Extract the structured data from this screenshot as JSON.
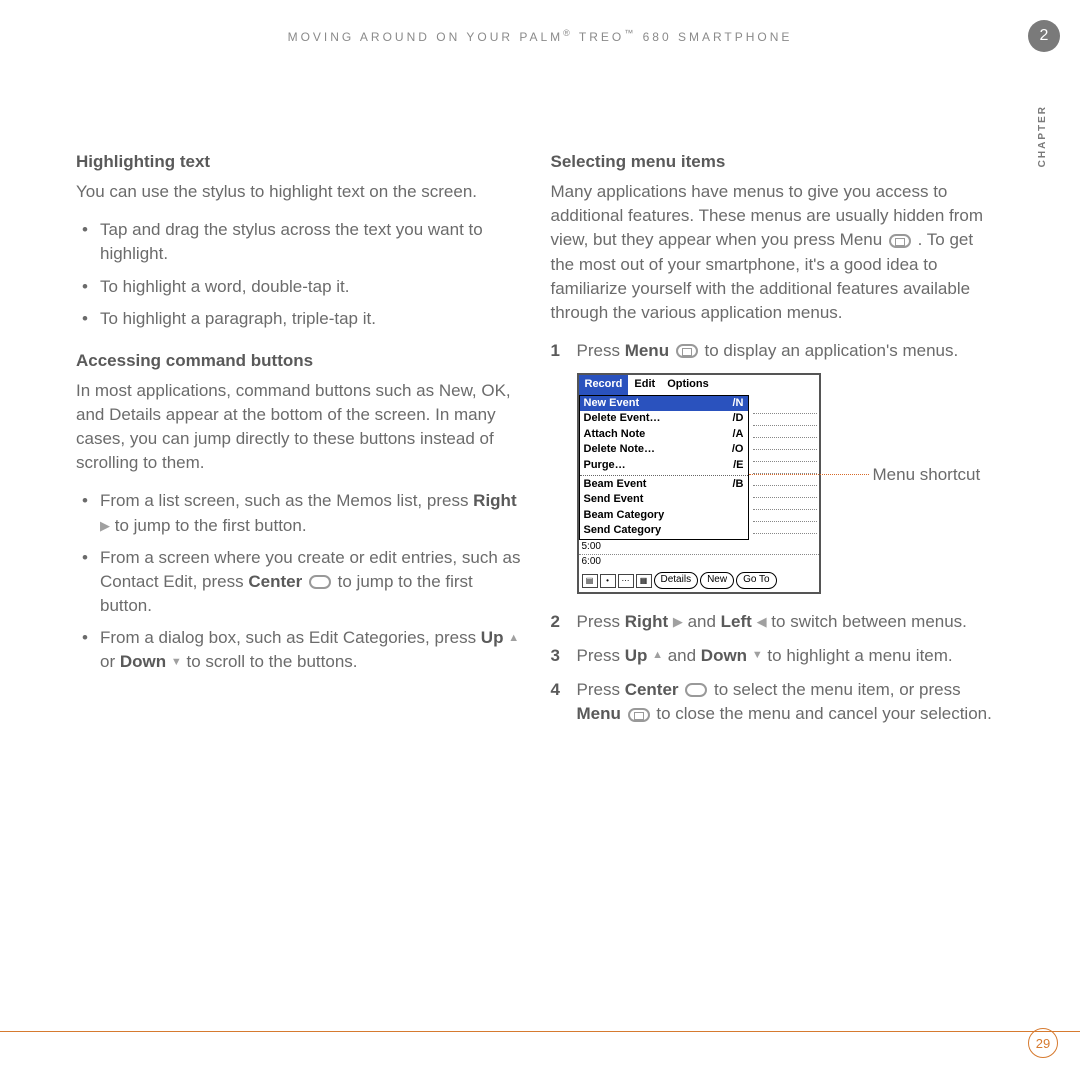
{
  "header": {
    "running_title_pre": "MOVING AROUND ON YOUR PALM",
    "running_title_mid": " TREO",
    "running_title_post": " 680 SMARTPHONE",
    "reg": "®",
    "tm": "™"
  },
  "chapter": {
    "number": "2",
    "label": "CHAPTER"
  },
  "left": {
    "h1": "Highlighting text",
    "p1": "You can use the stylus to highlight text on the screen.",
    "bullets1": [
      "Tap and drag the stylus across the text you want to highlight.",
      "To highlight a word, double-tap it.",
      "To highlight a paragraph, triple-tap it."
    ],
    "h2": "Accessing command buttons",
    "p2": "In most applications, command buttons such as New, OK, and Details appear at the bottom of the screen. In many cases, you can jump directly to these buttons instead of scrolling to them.",
    "b2a_pre": "From a list screen, such as the Memos list, press ",
    "b2a_key": "Right",
    "b2a_post": " to jump to the first button.",
    "b2b_pre": "From a screen where you create or edit entries, such as Contact Edit, press ",
    "b2b_key": "Center",
    "b2b_post": " to jump to the first button.",
    "b2c_pre": "From a dialog box, such as Edit Categories, press ",
    "b2c_up": "Up",
    "b2c_or": " or ",
    "b2c_down": "Down",
    "b2c_post": " to scroll to the buttons."
  },
  "right": {
    "h1": "Selecting menu items",
    "p1": "Many applications have menus to give you access to additional features. These menus are usually hidden from view, but they appear when you press Menu ",
    "p1b": " . To get the most out of your smartphone, it's a good idea to familiarize yourself with the additional features available through the various application menus.",
    "s1_pre": "Press ",
    "s1_key": "Menu",
    "s1_post": " to display an application's menus.",
    "callout": "Menu shortcut",
    "s2_pre": "Press ",
    "s2_right": "Right",
    "s2_and": " and ",
    "s2_left": "Left",
    "s2_post": " to switch between menus.",
    "s3_pre": "Press ",
    "s3_up": "Up",
    "s3_and": " and ",
    "s3_down": "Down",
    "s3_post": " to highlight a menu item.",
    "s4_pre": "Press ",
    "s4_center": "Center",
    "s4_mid": " to select the menu item, or press ",
    "s4_menu": "Menu",
    "s4_post": " to close the menu and cancel your selection."
  },
  "screenshot": {
    "tabs": [
      "Record",
      "Edit",
      "Options"
    ],
    "group1": [
      {
        "label": "New Event",
        "sc": "/N",
        "hi": true
      },
      {
        "label": "Delete Event…",
        "sc": "/D"
      },
      {
        "label": "Attach Note",
        "sc": "/A"
      },
      {
        "label": "Delete Note…",
        "sc": "/O"
      },
      {
        "label": "Purge…",
        "sc": "/E"
      }
    ],
    "group2": [
      {
        "label": "Beam Event",
        "sc": "/B"
      },
      {
        "label": "Send Event"
      },
      {
        "label": "Beam Category"
      },
      {
        "label": "Send Category"
      }
    ],
    "times": [
      "5:00",
      "6:00"
    ],
    "buttons": [
      "Details",
      "New",
      "Go To"
    ]
  },
  "footer": {
    "page": "29"
  }
}
